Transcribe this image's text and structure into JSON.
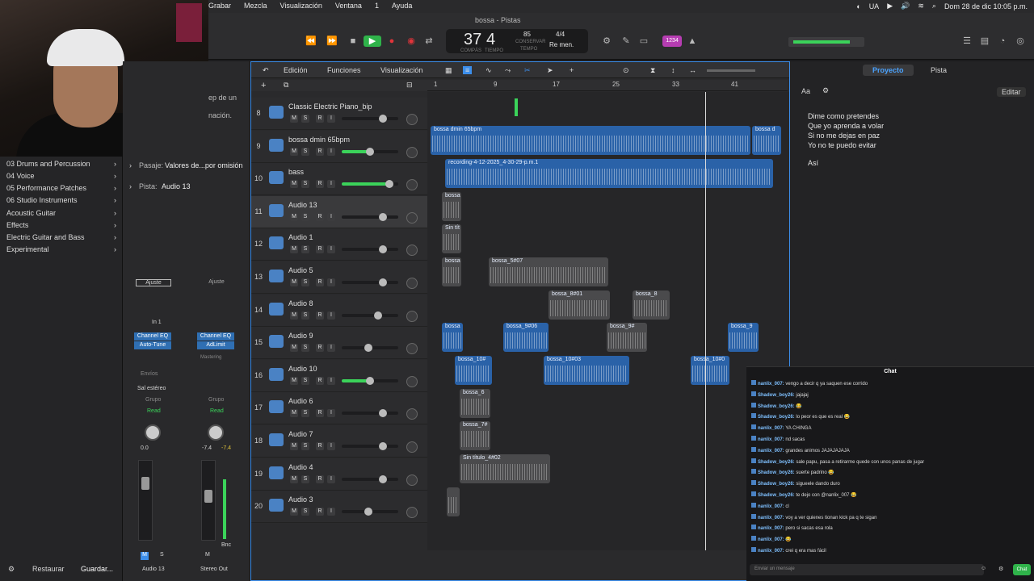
{
  "menubar": {
    "items": [
      "Grabar",
      "Mezcla",
      "Visualización",
      "Ventana",
      "1",
      "Ayuda"
    ],
    "lang": "UA",
    "datetime": "Dom 28 de dic  10:05 p.m."
  },
  "transport": {
    "title": "bossa - Pistas",
    "bars": "37",
    "beat": "4",
    "bars_label": "COMPÁS",
    "beat_label": "TIEMPO",
    "tempo": "85",
    "tempo_label": "CONSERVAR",
    "tempo_sub": "TEMPO",
    "sig": "4/4",
    "key": "Re men.",
    "count_in": "1234"
  },
  "library": {
    "items": [
      {
        "label": "03 Drums and Percussion",
        "chev": "›"
      },
      {
        "label": "04 Voice",
        "chev": "›"
      },
      {
        "label": "05 Performance Patches",
        "chev": "›"
      },
      {
        "label": "06 Studio Instruments",
        "chev": "›"
      },
      {
        "label": "Acoustic Guitar",
        "chev": "›"
      },
      {
        "label": "Effects",
        "chev": "›"
      },
      {
        "label": "Electric Guitar and Bass",
        "chev": "›"
      },
      {
        "label": "Experimental",
        "chev": "›"
      }
    ],
    "restore": "Restaurar",
    "save": "Guardar..."
  },
  "inspector": {
    "snippet1": "ep de un",
    "snippet2": "nación.",
    "region_label": "Pasaje:",
    "region_value": "Valores de...por omisión",
    "track_label": "Pista:",
    "track_value": "Audio 13",
    "left_strip": {
      "setting": "Ajuste",
      "input": "In 1",
      "eq": "Channel EQ",
      "plugin": "Auto-Tune",
      "sends": "Envíos",
      "output": "Sal estéreo",
      "group": "Grupo",
      "auto": "Read",
      "vol": "0.0",
      "name": "Audio 13",
      "m": "M",
      "s": "S"
    },
    "right_strip": {
      "setting": "Ajuste",
      "eq": "Channel EQ",
      "plugin": "AdLimit",
      "mastering": "Mastering",
      "group": "Grupo",
      "auto": "Read",
      "vol": "-7.4",
      "peak": "-7.4",
      "name": "Stereo Out",
      "m": "M",
      "bnc": "Bnc"
    }
  },
  "toolbar": {
    "edit": "Edición",
    "functions": "Funciones",
    "view": "Visualización"
  },
  "ruler": [
    "1",
    "9",
    "17",
    "25",
    "33",
    "41"
  ],
  "tracks": [
    {
      "num": "8",
      "name": "Classic Electric Piano_bip"
    },
    {
      "num": "9",
      "name": "bossa dmin 65bpm"
    },
    {
      "num": "10",
      "name": "bass"
    },
    {
      "num": "11",
      "name": "Audio 13"
    },
    {
      "num": "12",
      "name": "Audio 1"
    },
    {
      "num": "13",
      "name": "Audio 5"
    },
    {
      "num": "14",
      "name": "Audio 8"
    },
    {
      "num": "15",
      "name": "Audio 9"
    },
    {
      "num": "16",
      "name": "Audio 10"
    },
    {
      "num": "17",
      "name": "Audio 6"
    },
    {
      "num": "18",
      "name": "Audio 7"
    },
    {
      "num": "19",
      "name": "Audio 4"
    },
    {
      "num": "20",
      "name": "Audio 3"
    }
  ],
  "track_buttons": {
    "m": "M",
    "s": "S",
    "r": "R",
    "i": "I"
  },
  "regions": {
    "r1": "bossa dmin 65bpm",
    "r1b": "bossa d",
    "r2": "recording-4-12-2025_4-30-29-p.m.1",
    "r3": "bossa",
    "r4": "Sin tít",
    "r5": "bossa",
    "r6": "bossa_5#07",
    "r7": "bossa_8#01",
    "r8": "bossa_8",
    "r9": "bossa",
    "r10": "bossa_9#06",
    "r11": "bossa_9#",
    "r12": "bossa_9",
    "r13": "bossa_10#",
    "r14": "bossa_10#03",
    "r15": "bossa_10#0",
    "r16": "bossa_6",
    "r17": "bossa_7#",
    "r18": "Sin título_4#02"
  },
  "right_panel": {
    "tab_project": "Proyecto",
    "tab_track": "Pista",
    "font_btn": "Aa",
    "edit": "Editar",
    "lyrics": [
      "Dime como pretendes",
      "Que yo aprenda a volar",
      "Si no me dejas en paz",
      "Yo no te puedo evitar"
    ],
    "lyrics_end": "Así"
  },
  "chat": {
    "title": "Chat",
    "messages": [
      {
        "user": "nanlix_007:",
        "text": "vengo a decir q ya saquen ese corrido"
      },
      {
        "user": "Shadow_boy26:",
        "text": "jajajaj"
      },
      {
        "user": "Shadow_boy26:",
        "text": "😂"
      },
      {
        "user": "Shadow_boy26:",
        "text": "lo peor es que es real 😂"
      },
      {
        "user": "nanlix_007:",
        "text": "YA CHINGA"
      },
      {
        "user": "nanlix_007:",
        "text": "nd sacas"
      },
      {
        "user": "nanlix_007:",
        "text": "grandes animos JAJAJAJAJA"
      },
      {
        "user": "Shadow_boy26:",
        "text": "sale papu, pasa a retirarme quede con unos panas de jugar"
      },
      {
        "user": "Shadow_boy26:",
        "text": "suerte padrino 😂"
      },
      {
        "user": "Shadow_boy26:",
        "text": "sigueele dando duro"
      },
      {
        "user": "Shadow_boy26:",
        "text": "te dejo con @nanlix_007 😂"
      },
      {
        "user": "nanlix_007:",
        "text": "cl"
      },
      {
        "user": "nanlix_007:",
        "text": "voy a ver quienes tionan kick pa q te sigan"
      },
      {
        "user": "nanlix_007:",
        "text": "pero si sacas esa rola"
      },
      {
        "user": "nanlix_007:",
        "text": "😂"
      },
      {
        "user": "nanlix_007:",
        "text": "crei q era mas fácil"
      }
    ],
    "placeholder": "Enviar un mensaje",
    "send": "Chat"
  }
}
